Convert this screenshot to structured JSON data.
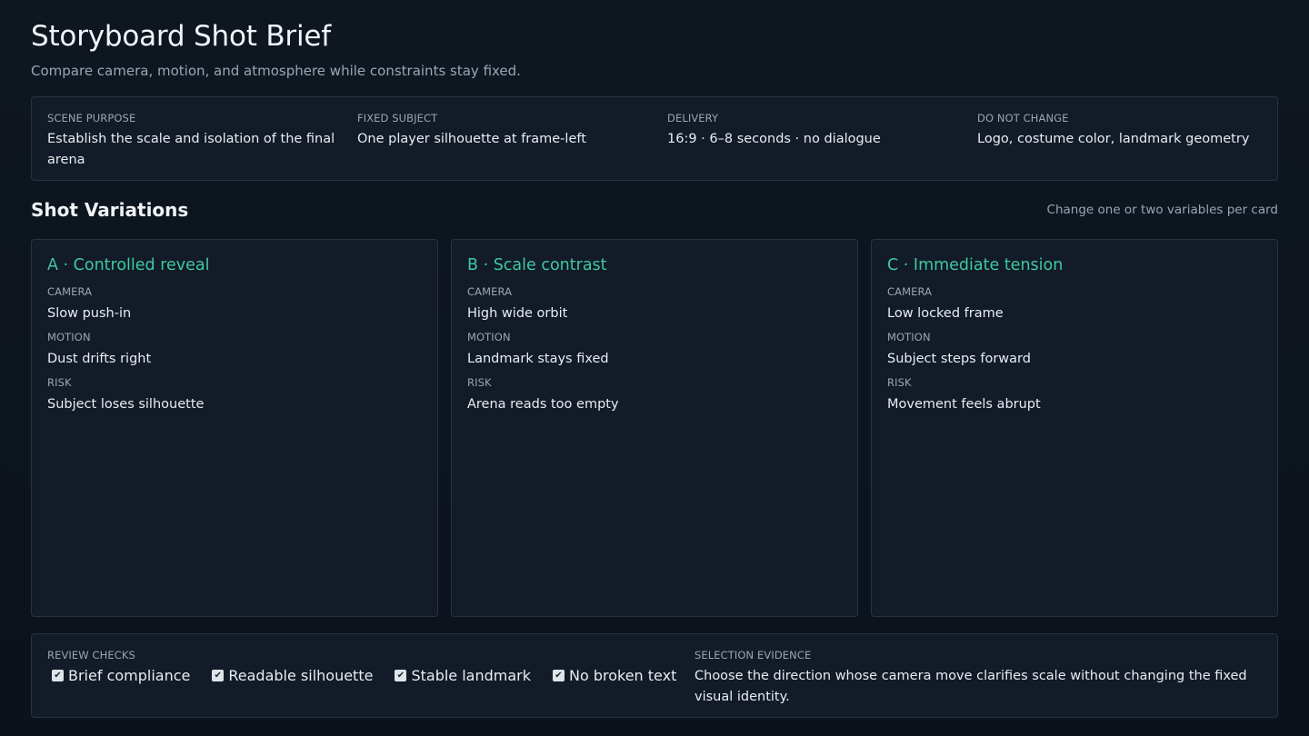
{
  "header": {
    "title": "Storyboard Shot Brief",
    "subtitle": "Compare camera, motion, and atmosphere while constraints stay fixed."
  },
  "brief": [
    {
      "label": "SCENE PURPOSE",
      "value": "Establish the scale and isolation of the final arena"
    },
    {
      "label": "FIXED SUBJECT",
      "value": "One player silhouette at frame-left"
    },
    {
      "label": "DELIVERY",
      "value": "16:9 · 6–8 seconds · no dialogue"
    },
    {
      "label": "DO NOT CHANGE",
      "value": "Logo, costume color, landmark geometry"
    }
  ],
  "variations": {
    "title": "Shot Variations",
    "hint": "Change one or two variables per card",
    "cards": [
      {
        "title": "A · Controlled reveal",
        "fields": [
          {
            "label": "CAMERA",
            "value": "Slow push-in"
          },
          {
            "label": "MOTION",
            "value": "Dust drifts right"
          },
          {
            "label": "RISK",
            "value": "Subject loses silhouette"
          }
        ]
      },
      {
        "title": "B · Scale contrast",
        "fields": [
          {
            "label": "CAMERA",
            "value": "High wide orbit"
          },
          {
            "label": "MOTION",
            "value": "Landmark stays fixed"
          },
          {
            "label": "RISK",
            "value": "Arena reads too empty"
          }
        ]
      },
      {
        "title": "C · Immediate tension",
        "fields": [
          {
            "label": "CAMERA",
            "value": "Low locked frame"
          },
          {
            "label": "MOTION",
            "value": "Subject steps forward"
          },
          {
            "label": "RISK",
            "value": "Movement feels abrupt"
          }
        ]
      }
    ]
  },
  "review": {
    "label": "REVIEW CHECKS",
    "checks": [
      {
        "label": "Brief compliance",
        "checked": true
      },
      {
        "label": "Readable silhouette",
        "checked": true
      },
      {
        "label": "Stable landmark",
        "checked": true
      },
      {
        "label": "No broken text",
        "checked": true
      }
    ],
    "evidence_label": "SELECTION EVIDENCE",
    "evidence_text": "Choose the direction whose camera move clarifies scale without changing the fixed visual identity."
  },
  "colors": {
    "background": "#0e1620",
    "panel": "#121b27",
    "border": "#263343",
    "accent": "#3fc9a0"
  },
  "icons": {
    "check": "checkbox-checked-icon"
  }
}
